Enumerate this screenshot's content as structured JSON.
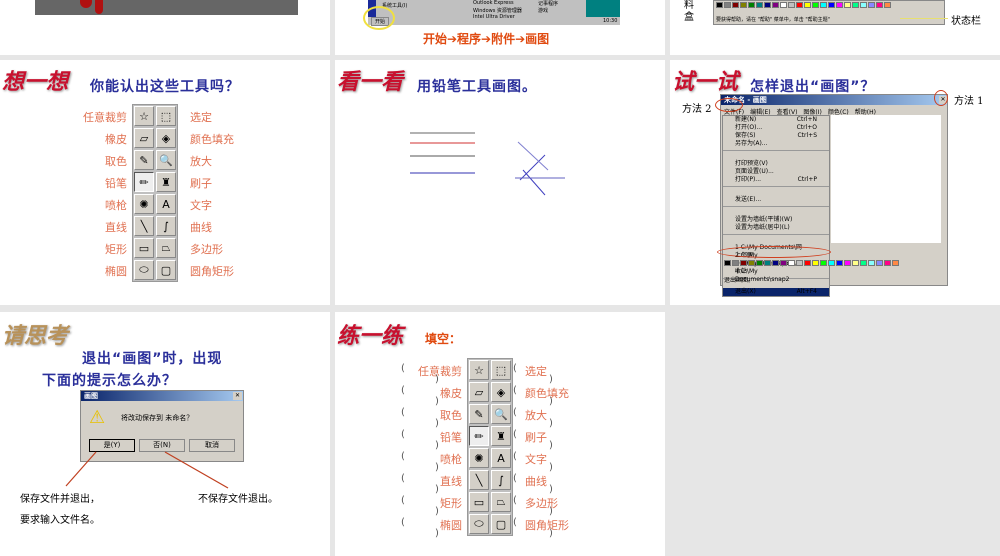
{
  "top_row": {
    "slide2_caption": "开始➔程序➔附件➔画图",
    "slide2_menu_items": [
      "系统工具(I)",
      "Outlook Express",
      "Windows 资源管理器",
      "Intel Ultra Driver",
      "记事程序",
      "游戏"
    ],
    "slide2_start": "开始",
    "slide2_clock": "10:30",
    "slide3_palette_label": "料盒",
    "slide3_status_label": "状态栏",
    "slide3_status_text": "要获得帮助，请在 \"帮助\" 菜单中，单击 \"帮助主题\""
  },
  "think": {
    "logo": "想一想",
    "question": "你能认出这些工具吗？",
    "left_labels": [
      "任意裁剪",
      "橡皮",
      "取色",
      "铅笔",
      "喷枪",
      "直线",
      "矩形",
      "椭圆"
    ],
    "right_labels": [
      "选定",
      "颜色填充",
      "放大",
      "刷子",
      "文字",
      "曲线",
      "多边形",
      "圆角矩形"
    ]
  },
  "look": {
    "logo": "看一看",
    "instruction": "用铅笔工具画图。"
  },
  "try": {
    "logo": "试一试",
    "question": "怎样退出“画图”？",
    "method1": "方法 1",
    "method2": "方法 2",
    "window_title": "未命名 - 画图",
    "menubar": [
      "文件(F)",
      "编辑(E)",
      "查看(V)",
      "图像(I)",
      "颜色(C)",
      "帮助(H)"
    ],
    "file_menu": [
      {
        "label": "新建(N)",
        "shortcut": "Ctrl+N"
      },
      {
        "label": "打开(O)...",
        "shortcut": "Ctrl+O"
      },
      {
        "label": "保存(S)",
        "shortcut": "Ctrl+S"
      },
      {
        "label": "另存为(A)...",
        "shortcut": ""
      },
      {
        "label": "打印预览(V)",
        "shortcut": ""
      },
      {
        "label": "页面设置(U)...",
        "shortcut": ""
      },
      {
        "label": "打印(P)...",
        "shortcut": "Ctrl+P"
      },
      {
        "label": "发送(E)...",
        "shortcut": ""
      },
      {
        "label": "设置为墙纸(平铺)(W)",
        "shortcut": ""
      },
      {
        "label": "设置为墙纸(居中)(L)",
        "shortcut": ""
      },
      {
        "label": "1 C:\\My Documents\\网上邻居",
        "shortcut": ""
      },
      {
        "label": "2 C:\\My Documents\\snap3",
        "shortcut": ""
      },
      {
        "label": "3 C:\\My Documents\\回收站",
        "shortcut": ""
      },
      {
        "label": "4 C:\\My Documents\\snap2",
        "shortcut": ""
      }
    ],
    "exit_item": {
      "label": "退出(X)",
      "shortcut": "Alt+F4"
    },
    "status": "退出画图。"
  },
  "ponder": {
    "logo": "请思考",
    "question_line1": "退出“画图”时，出现",
    "question_line2": "下面的提示怎么办？",
    "dialog_title": "画图",
    "dialog_message": "将改动保存到 未命名？",
    "buttons": [
      "是(Y)",
      "否(N)",
      "取消"
    ],
    "note_yes_1": "保存文件并退出，",
    "note_yes_2": "要求输入文件名。",
    "note_no": "不保存文件退出。"
  },
  "practice": {
    "logo": "练一练",
    "instruction": "填空：",
    "left_labels": [
      "任意裁剪",
      "橡皮",
      "取色",
      "铅笔",
      "喷枪",
      "直线",
      "矩形",
      "椭圆"
    ],
    "right_labels": [
      "选定",
      "颜色填充",
      "放大",
      "刷子",
      "文字",
      "曲线",
      "多边形",
      "圆角矩形"
    ]
  },
  "tools": [
    "☆",
    "⬚",
    "▱",
    "◈",
    "✎",
    "🔍",
    "✏",
    "♜",
    "✺",
    "A",
    "╲",
    "∫",
    "▭",
    "⏢",
    "⬭",
    "▢"
  ],
  "palette": [
    "#000",
    "#808080",
    "#800000",
    "#808000",
    "#008000",
    "#008080",
    "#000080",
    "#800080",
    "#fff",
    "#c0c0c0",
    "#f00",
    "#ff0",
    "#0f0",
    "#0ff",
    "#00f",
    "#f0f",
    "#ff8",
    "#0f8",
    "#8ff",
    "#88f",
    "#f08",
    "#f84"
  ]
}
